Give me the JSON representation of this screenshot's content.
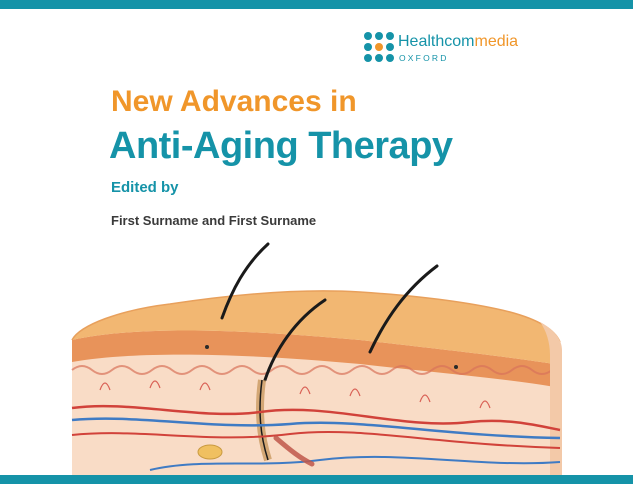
{
  "publisher": {
    "name_part1": "Healthcom",
    "name_part2": "media",
    "location": "OXFORD"
  },
  "book": {
    "title_line1": "New Advances in",
    "title_line2": "Anti-Aging Therapy",
    "edited_by": "Edited by",
    "authors": "First Surname and First Surname"
  },
  "illustration": {
    "subject": "skin-cross-section-with-hair-follicles"
  },
  "colors": {
    "teal": "#1593a8",
    "orange": "#f0962a",
    "skin": "#f2b772",
    "text_dark": "#3a3a3a",
    "dermis": "#f9dcc6",
    "vein_red": "#d1423a",
    "vein_blue": "#3f7bc4"
  }
}
